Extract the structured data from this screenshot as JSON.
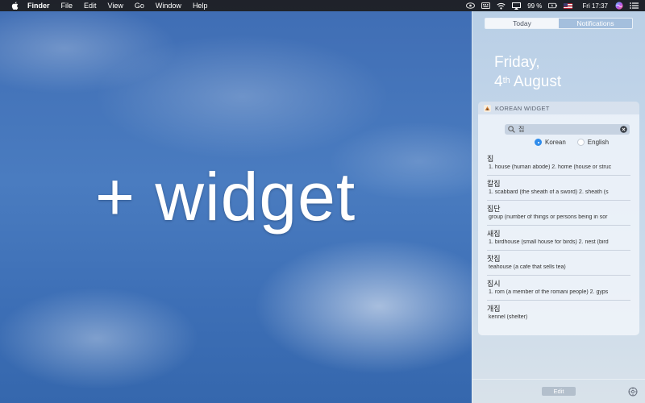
{
  "menubar": {
    "apple_icon": "apple-icon",
    "app_name": "Finder",
    "items": [
      "File",
      "Edit",
      "View",
      "Go",
      "Window",
      "Help"
    ],
    "battery": "99 %",
    "flag_icon": "us-flag-icon",
    "clock": "Fri 17:37"
  },
  "desktop": {
    "headline": "+ widget"
  },
  "notification_center": {
    "tabs": [
      {
        "label": "Today",
        "active": true
      },
      {
        "label": "Notifications",
        "active": false
      }
    ],
    "date_line1": "Friday,",
    "date_day": "4",
    "date_suffix": "th",
    "date_month": " August",
    "widget": {
      "title": "KOREAN WIDGET",
      "search_value": "집",
      "radios": [
        {
          "label": "Korean",
          "selected": true
        },
        {
          "label": "English",
          "selected": false
        }
      ],
      "results": [
        {
          "word": "집",
          "definition": "1. house (human abode) 2. home (house or struc"
        },
        {
          "word": "칼집",
          "definition": "1. scabbard (the sheath of a sword) 2. sheath (s"
        },
        {
          "word": "집단",
          "definition": "group (number of things or persons being in sor"
        },
        {
          "word": "새집",
          "definition": "1. birdhouse (small house for birds) 2. nest (bird"
        },
        {
          "word": "찻집",
          "definition": "teahouse (a cafe that sells tea)"
        },
        {
          "word": "집시",
          "definition": "1. rom (a member of the romani people) 2. gyps"
        },
        {
          "word": "개집",
          "definition": "kennel (shelter)"
        }
      ]
    },
    "edit_label": "Edit"
  },
  "colors": {
    "accent": "#2f8ceb",
    "menubar": "#1c1c1e",
    "sky": "#4a7cc0"
  }
}
